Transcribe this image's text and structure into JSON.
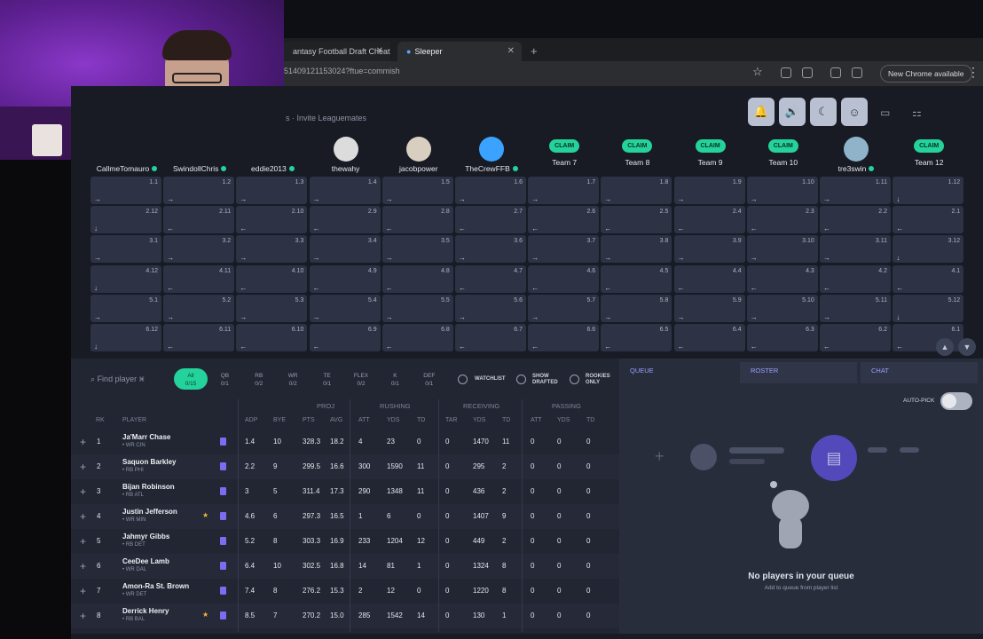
{
  "browser": {
    "tabs": [
      {
        "label": "antasy Football Draft Cheat"
      },
      {
        "label": "Sleeper"
      }
    ],
    "url": "51409121153024?ftue=commish",
    "chrome_available": "New Chrome available"
  },
  "header": {
    "invite_text": "s · Invite Leaguemates"
  },
  "teams": [
    {
      "name": "CallmeTomauro",
      "claim": false,
      "online": true
    },
    {
      "name": "SwindollChris",
      "claim": false,
      "online": true
    },
    {
      "name": "eddie2013",
      "claim": false,
      "online": true
    },
    {
      "name": "thewahy",
      "claim": false,
      "online": false
    },
    {
      "name": "jacobpower",
      "claim": false,
      "online": false
    },
    {
      "name": "TheCrewFFB",
      "claim": false,
      "online": true
    },
    {
      "name": "Team 7",
      "claim": true,
      "online": false
    },
    {
      "name": "Team 8",
      "claim": true,
      "online": false
    },
    {
      "name": "Team 9",
      "claim": true,
      "online": false
    },
    {
      "name": "Team 10",
      "claim": true,
      "online": false
    },
    {
      "name": "tre3swin",
      "claim": false,
      "online": true
    },
    {
      "name": "Team 12",
      "claim": true,
      "online": false
    }
  ],
  "claim_label": "CLAIM",
  "draft_rounds": [
    {
      "round": 1,
      "picks": [
        "1.1",
        "1.2",
        "1.3",
        "1.4",
        "1.5",
        "1.6",
        "1.7",
        "1.8",
        "1.9",
        "1.10",
        "1.11",
        "1.12"
      ],
      "dir": "→"
    },
    {
      "round": 2,
      "picks": [
        "2.12",
        "2.11",
        "2.10",
        "2.9",
        "2.8",
        "2.7",
        "2.6",
        "2.5",
        "2.4",
        "2.3",
        "2.2",
        "2.1"
      ],
      "dir": "←"
    },
    {
      "round": 3,
      "picks": [
        "3.1",
        "3.2",
        "3.3",
        "3.4",
        "3.5",
        "3.6",
        "3.7",
        "3.8",
        "3.9",
        "3.10",
        "3.11",
        "3.12"
      ],
      "dir": "→"
    },
    {
      "round": 4,
      "picks": [
        "4.12",
        "4.11",
        "4.10",
        "4.9",
        "4.8",
        "4.7",
        "4.6",
        "4.5",
        "4.4",
        "4.3",
        "4.2",
        "4.1"
      ],
      "dir": "←"
    },
    {
      "round": 5,
      "picks": [
        "5.1",
        "5.2",
        "5.3",
        "5.4",
        "5.5",
        "5.6",
        "5.7",
        "5.8",
        "5.9",
        "5.10",
        "5.11",
        "5.12"
      ],
      "dir": "→"
    },
    {
      "round": 6,
      "picks": [
        "6.12",
        "6.11",
        "6.10",
        "6.9",
        "6.8",
        "6.7",
        "6.6",
        "6.5",
        "6.4",
        "6.3",
        "6.2",
        "6.1"
      ],
      "dir": "←"
    }
  ],
  "filters": {
    "search_placeholder": "Find player ⌘",
    "positions": [
      {
        "label": "All",
        "count": "0/15"
      },
      {
        "label": "QB",
        "count": "0/1"
      },
      {
        "label": "RB",
        "count": "0/2"
      },
      {
        "label": "WR",
        "count": "0/2"
      },
      {
        "label": "TE",
        "count": "0/1"
      },
      {
        "label": "FLEX",
        "count": "0/2"
      },
      {
        "label": "K",
        "count": "0/1"
      },
      {
        "label": "DEF",
        "count": "0/1"
      }
    ],
    "watchlist": "WATCHLIST",
    "show_drafted": "SHOW DRAFTED",
    "rookies_only": "ROOKIES ONLY"
  },
  "table": {
    "groups": [
      "PROJ",
      "RUSHING",
      "RECEIVING",
      "PASSING"
    ],
    "headers": [
      "RK",
      "PLAYER",
      "ADP",
      "BYE",
      "PTS",
      "AVG",
      "ATT",
      "YDS",
      "TD",
      "TAR",
      "YDS",
      "TD",
      "ATT",
      "YDS",
      "TD"
    ],
    "rows": [
      {
        "rk": "1",
        "name": "Ja'Marr Chase",
        "pos": "• WR CIN",
        "star": false,
        "adp": "1.4",
        "bye": "10",
        "pts": "328.3",
        "avg": "18.2",
        "r_att": "4",
        "r_yds": "23",
        "r_td": "0",
        "tar": "0",
        "rec_yds": "1470",
        "rec_td": "11",
        "p_att": "0",
        "p_yds": "0",
        "p_td": "0"
      },
      {
        "rk": "2",
        "name": "Saquon Barkley",
        "pos": "• RB PHI",
        "star": false,
        "adp": "2.2",
        "bye": "9",
        "pts": "299.5",
        "avg": "16.6",
        "r_att": "300",
        "r_yds": "1590",
        "r_td": "11",
        "tar": "0",
        "rec_yds": "295",
        "rec_td": "2",
        "p_att": "0",
        "p_yds": "0",
        "p_td": "0"
      },
      {
        "rk": "3",
        "name": "Bijan Robinson",
        "pos": "• RB ATL",
        "star": false,
        "adp": "3",
        "bye": "5",
        "pts": "311.4",
        "avg": "17.3",
        "r_att": "290",
        "r_yds": "1348",
        "r_td": "11",
        "tar": "0",
        "rec_yds": "436",
        "rec_td": "2",
        "p_att": "0",
        "p_yds": "0",
        "p_td": "0"
      },
      {
        "rk": "4",
        "name": "Justin Jefferson",
        "pos": "• WR MIN",
        "star": true,
        "adp": "4.6",
        "bye": "6",
        "pts": "297.3",
        "avg": "16.5",
        "r_att": "1",
        "r_yds": "6",
        "r_td": "0",
        "tar": "0",
        "rec_yds": "1407",
        "rec_td": "9",
        "p_att": "0",
        "p_yds": "0",
        "p_td": "0"
      },
      {
        "rk": "5",
        "name": "Jahmyr Gibbs",
        "pos": "• RB DET",
        "star": false,
        "adp": "5.2",
        "bye": "8",
        "pts": "303.3",
        "avg": "16.9",
        "r_att": "233",
        "r_yds": "1204",
        "r_td": "12",
        "tar": "0",
        "rec_yds": "449",
        "rec_td": "2",
        "p_att": "0",
        "p_yds": "0",
        "p_td": "0"
      },
      {
        "rk": "6",
        "name": "CeeDee Lamb",
        "pos": "• WR DAL",
        "star": false,
        "adp": "6.4",
        "bye": "10",
        "pts": "302.5",
        "avg": "16.8",
        "r_att": "14",
        "r_yds": "81",
        "r_td": "1",
        "tar": "0",
        "rec_yds": "1324",
        "rec_td": "8",
        "p_att": "0",
        "p_yds": "0",
        "p_td": "0"
      },
      {
        "rk": "7",
        "name": "Amon-Ra St. Brown",
        "pos": "• WR DET",
        "star": false,
        "adp": "7.4",
        "bye": "8",
        "pts": "276.2",
        "avg": "15.3",
        "r_att": "2",
        "r_yds": "12",
        "r_td": "0",
        "tar": "0",
        "rec_yds": "1220",
        "rec_td": "8",
        "p_att": "0",
        "p_yds": "0",
        "p_td": "0"
      },
      {
        "rk": "8",
        "name": "Derrick Henry",
        "pos": "• RB BAL",
        "star": true,
        "adp": "8.5",
        "bye": "7",
        "pts": "270.2",
        "avg": "15.0",
        "r_att": "285",
        "r_yds": "1542",
        "r_td": "14",
        "tar": "0",
        "rec_yds": "130",
        "rec_td": "1",
        "p_att": "0",
        "p_yds": "0",
        "p_td": "0"
      }
    ]
  },
  "queue": {
    "tabs": [
      "QUEUE",
      "ROSTER",
      "CHAT"
    ],
    "autopick_label": "AUTO-PICK",
    "empty_title": "No players in your queue",
    "empty_sub": "Add to queue from player list"
  },
  "colors": {
    "accent": "#24d39b",
    "bg": "#181b24",
    "cell": "#2d3245"
  }
}
